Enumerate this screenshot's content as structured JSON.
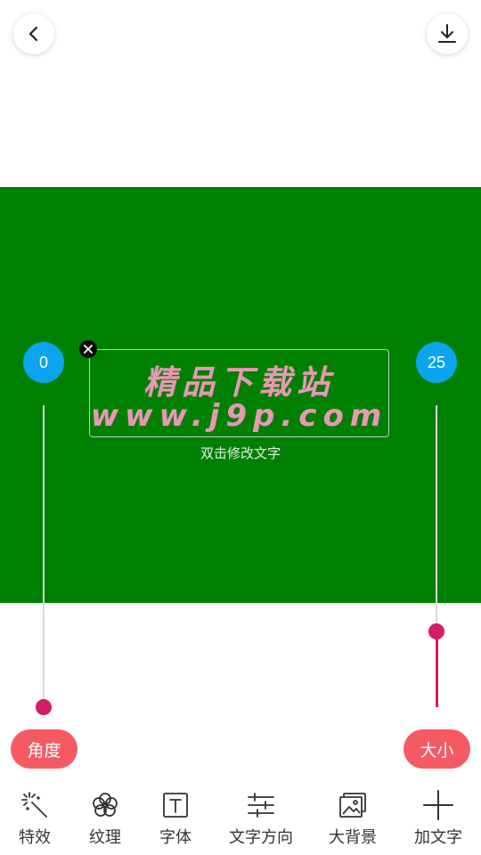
{
  "canvas": {
    "background_color": "#008000",
    "text_lines": [
      "精品下载站",
      "www.j9p.com"
    ],
    "text_color": "#e49ab2",
    "hint": "双击修改文字"
  },
  "angle": {
    "value": "0",
    "label": "角度",
    "slider_fraction": 0.0
  },
  "size": {
    "value": "25",
    "label": "大小",
    "slider_fraction": 0.25
  },
  "accent": {
    "slider": "#d31d64",
    "bubble": "#0ba4ee",
    "pill": "#f55a63"
  },
  "toolbar": [
    {
      "icon": "magic-wand-icon",
      "label": "特效"
    },
    {
      "icon": "flower-icon",
      "label": "纹理"
    },
    {
      "icon": "text-box-icon",
      "label": "字体"
    },
    {
      "icon": "sliders-icon",
      "label": "文字方向"
    },
    {
      "icon": "image-icon",
      "label": "大背景"
    },
    {
      "icon": "plus-icon",
      "label": "加文字"
    }
  ]
}
